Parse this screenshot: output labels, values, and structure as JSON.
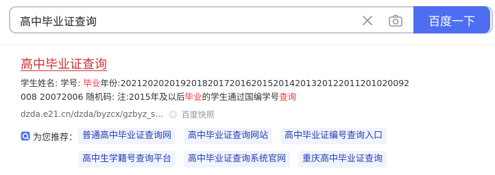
{
  "search": {
    "query": "高中毕业证查询",
    "button_label": "百度一下"
  },
  "result": {
    "title": "高中毕业证查询",
    "snippet_parts": [
      "学生姓名: 学号: ",
      "毕业",
      "年份:20212020201920182017201620152014201320122011201020092008 20072006 随机码: 注:2015年及以后",
      "毕业",
      "的学生通过国编学号",
      "查询"
    ],
    "url": "dzda.e21.cn/dzda/byzcx/gzbyz_s...",
    "snapshot_label": "百度快照"
  },
  "recommend": {
    "label": "为您推荐：",
    "row1": [
      "普通高中毕业证查询网",
      "高中毕业证查询网站",
      "高中毕业证编号查询入口"
    ],
    "row2": [
      "高中生学籍号查询平台",
      "高中毕业证查询系统官网",
      "重庆高中毕业证查询"
    ]
  },
  "colors": {
    "accent": "#4e6ef2",
    "title_red": "#cc3333",
    "highlight_red": "#f73131",
    "tag_bg": "#f1f3fd",
    "tag_text": "#2440b3"
  }
}
